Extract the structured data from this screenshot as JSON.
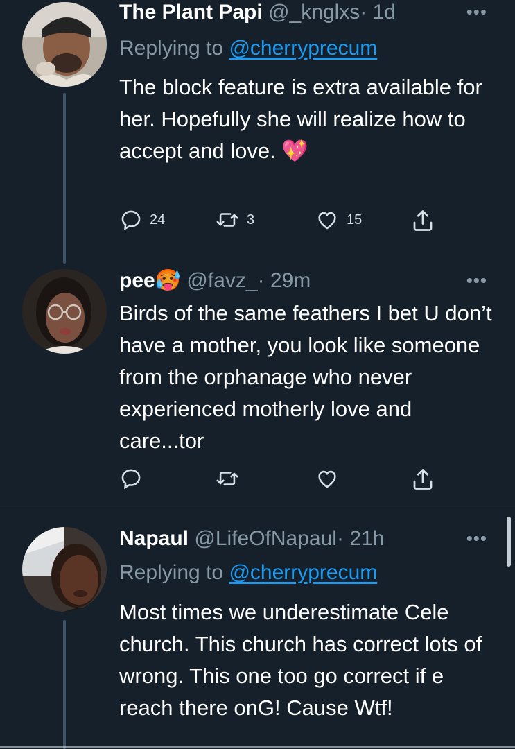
{
  "colors": {
    "background": "#15202b",
    "secondary_text": "#8899a6",
    "link": "#1d9bf0",
    "divider": "#38444d"
  },
  "tweets": [
    {
      "name": "The Plant Papi",
      "handle": "@_knglxs",
      "time": "· 1d",
      "more": "•••",
      "replying_prefix": "Replying to ",
      "replying_to": "@cherryprecum",
      "text": "The block feature is extra available for her. Hopefully she will realize how to accept and love. 💖",
      "replies": "24",
      "retweets": "3",
      "likes": "15"
    },
    {
      "name": "pee🥵",
      "handle": "@favz_",
      "time": "· 29m",
      "more": "•••",
      "text": "Birds of the same feathers I bet U don’t have a mother, you look like someone from the orphanage who never experienced motherly love and care...tor"
    },
    {
      "name": "Napaul",
      "handle": "@LifeOfNapaul",
      "time": "· 21h",
      "more": "•••",
      "replying_prefix": "Replying to ",
      "replying_to": "@cherryprecum",
      "text": "Most times we underestimate Cele church. This church has correct lots of wrong. This one too go correct if e reach there onG! Cause Wtf!"
    }
  ],
  "icons": [
    "reply-icon",
    "retweet-icon",
    "like-icon",
    "share-icon"
  ]
}
